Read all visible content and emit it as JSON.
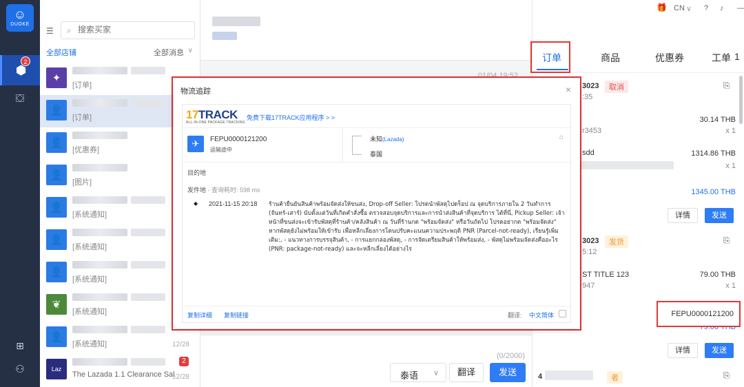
{
  "rail": {
    "brand": "DUOKE",
    "badge": "2"
  },
  "convlist": {
    "search_placeholder": "搜索买家",
    "all_shops": "全部店铺",
    "all_messages": "全部消息",
    "items": [
      {
        "preview": "[订单]",
        "time": "",
        "unread": ""
      },
      {
        "preview": "[订单]",
        "time": "",
        "unread": ""
      },
      {
        "preview": "[优惠券]",
        "time": "",
        "unread": ""
      },
      {
        "preview": "[图片]",
        "time": "",
        "unread": ""
      },
      {
        "preview": "[系统通知]",
        "time": "",
        "unread": ""
      },
      {
        "preview": "[系统通知]",
        "time": "",
        "unread": ""
      },
      {
        "preview": "[系统通知]",
        "time": "",
        "unread": ""
      },
      {
        "preview": "[系统通知]",
        "time": "",
        "unread": ""
      },
      {
        "preview": "[系统通知]",
        "time": "12/28",
        "unread": ""
      },
      {
        "preview": "The Lazada 1.1 Clearance Sal...",
        "time": "12/28",
        "unread": "2"
      }
    ]
  },
  "chat": {
    "timestamp": "01/04 19:52",
    "char_count": "(0/2000)",
    "language": "泰语",
    "translate": "翻译",
    "send": "发送"
  },
  "topbar": {
    "lang": "CN"
  },
  "tabs": [
    "订单",
    "商品",
    "优惠券",
    "工单"
  ],
  "tab_extra": "1",
  "orders": {
    "o1_id": "3023",
    "o1_tag": "取消",
    "o1_time": ":35",
    "o1_price1": "30.14 THB",
    "o1_qty1": "x 1",
    "o1_ref": "r3453",
    "o1_item2": "sdd",
    "o1_price2": "1314.86 THB",
    "o1_qty2": "x 1",
    "o1_total": "1345.00 THB",
    "o2_id": "3023",
    "o2_tag": "发货",
    "o2_time": "5:12",
    "o2_item": "ST TITLE 123",
    "o2_ref": "947",
    "o2_price": "79.00 THB",
    "o2_qty": "x 1",
    "o2_tracking": "FEPU0000121200",
    "o2_total": "79.00 THB",
    "o3_id": "4",
    "o3_tag": "者",
    "detail": "详情",
    "send": "发送"
  },
  "modal": {
    "title": "物流追踪",
    "logo_main": "TRACK",
    "logo_num": "17",
    "logo_sub": "ALL-IN-ONE PACKAGE TRACKING",
    "download": "免费下载17TRACK应用程序 > >",
    "tracking_no": "FEPU0000121200",
    "status": "运输途中",
    "carrier": "未知",
    "carrier_sub": "(Lazada)",
    "country": "泰国",
    "destination": "目的地",
    "origin": "发件地",
    "query_time": " - 查询耗时: 598 ms",
    "event_time": "2021-11-15 20:18",
    "event_text": "ร้านค้ายืนยันสินค้าพร้อมจัดส่งให้ขนส่ง, Drop-off Seller: โปรดนำพัสดุไปดร็อป ณ จุดบริการภายใน 2 วันทำการ (จันทร์-เสาร์) นับตั้งแต่วันที่เกิดคำสั่งซื้อ ตรวจสอบจุดบริการและการนำส่งสินค้าที่จุดบริการ ได้ที่นี่, Pickup Seller: เจ้าหน้าที่ขนส่งจะเข้ารับพัสดุที่ร้านค้า/คลังสินค้า ณ วันที่ร้านกด \"พร้อมจัดส่ง\" หรือวันถัดไป โปรดอย่ากด \"พร้อมจัดส่ง\" หากพัสดุยังไม่พร้อมให้เข้ารับ เพื่อหลีกเลี่ยงการโดนปรับคะแนนความประพฤติ PNR (Parcel-not-ready), เรียนรู้เพิ่มเติม:, - แนวทางการบรรจุสินค้า, - การแยกกล่องพัสดุ, - การจัดเตรียมสินค้าให้พร้อมส่ง, - พัสดุไม่พร้อมจัดส่งคืออะไร (PNR: package-not-ready) และจะหลีกเลี่ยงได้อย่างไร",
    "copy_detail": "复制详细",
    "copy_link": "复制链接",
    "translate_label": "翻译:",
    "translate_lang": "中文简体"
  }
}
